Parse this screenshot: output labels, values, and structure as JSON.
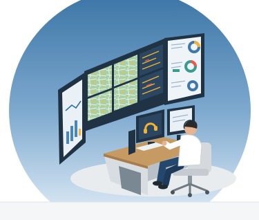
{
  "illustration": {
    "subject": "control-room-operator-illustration",
    "colors": {
      "circle_top": "#3f78a8",
      "circle_bottom": "#b9d4ea",
      "monitor_frame": "#1f3344",
      "screen_dark": "#233a4f",
      "screen_map": "#9cc6a0",
      "screen_light": "#eef4f8",
      "desk_top": "#c59a63",
      "desk_body": "#d8dde2",
      "floor_shadow": "#e4e8ec",
      "accent_yellow": "#f2b233",
      "shirt": "#ffffff",
      "trousers": "#24476e",
      "chair": "#d5d9dd"
    },
    "icons": [
      "headset-icon",
      "donut-chart-icon",
      "bar-chart-icon",
      "map-icon"
    ]
  }
}
